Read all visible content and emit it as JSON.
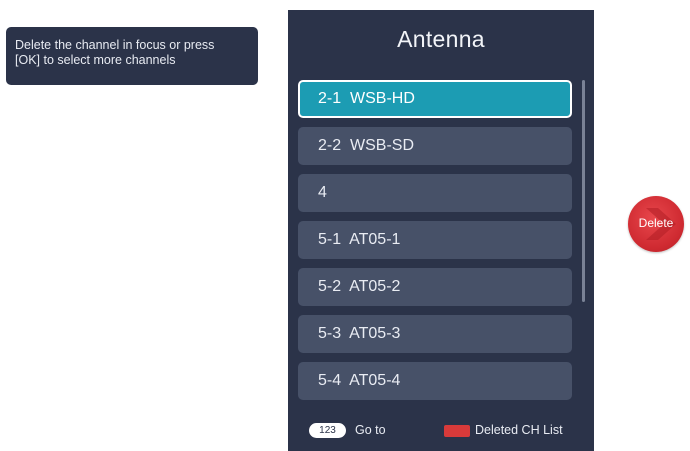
{
  "tooltip": {
    "line1": "Delete the channel in focus or press",
    "line2": "[OK] to select more channels"
  },
  "panel": {
    "title": "Antenna",
    "channels": [
      {
        "label": "2-1  WSB-HD",
        "focused": true
      },
      {
        "label": "2-2  WSB-SD",
        "focused": false
      },
      {
        "label": "4",
        "focused": false
      },
      {
        "label": "5-1  AT05-1",
        "focused": false
      },
      {
        "label": "5-2  AT05-2",
        "focused": false
      },
      {
        "label": "5-3  AT05-3",
        "focused": false
      },
      {
        "label": "5-4  AT05-4",
        "focused": false
      }
    ]
  },
  "footer": {
    "key_badge": "123",
    "goto_label": "Go to",
    "red_key_label": "Deleted CH List"
  },
  "delete_button": {
    "label": "Delete"
  },
  "colors": {
    "panel_bg": "#2b3349",
    "row_bg": "#475168",
    "focus_bg": "#1c9cb3",
    "delete_red": "#cf2a31",
    "red_key": "#d83a3a"
  },
  "icons": {
    "red_key": "red-color-key-icon",
    "delete_chevron": "chevron-right-icon"
  }
}
